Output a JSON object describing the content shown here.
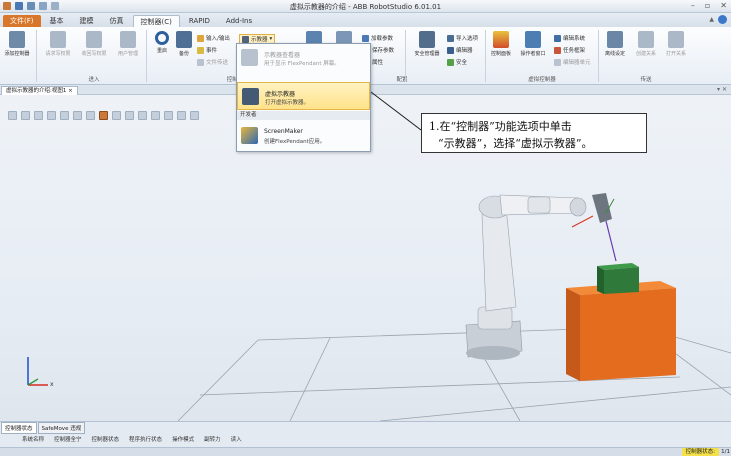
{
  "window": {
    "title": "虚拟示教器的介绍 - ABB RobotStudio 6.01.01"
  },
  "tabs": [
    "文件(F)",
    "基本",
    "建模",
    "仿真",
    "控制器(C)",
    "RAPID",
    "Add-Ins"
  ],
  "ribbon": {
    "add_controller": "添加控制器",
    "request_write": "请求写权限",
    "release_write": "收回写权限",
    "user_manage": "用户管理",
    "restart": "重启",
    "backup": "备份",
    "io": "输入/输出",
    "events": "事件",
    "file_transfer": "文件传送",
    "teach_pendant": "示教器",
    "load_params": "加载参数",
    "save_params": "保存参数",
    "properties": "属性",
    "safety_manager": "安全管理器",
    "import_option": "导入选项",
    "encoder": "编辑器",
    "safety": "安全",
    "control_panel": "控制面板",
    "operator_window": "操作者窗口",
    "edit_system": "编辑系统",
    "task_frame": "任务框架",
    "mech_unit": "编辑器单元",
    "offline": "离线设定",
    "create_relation": "创建关系",
    "open_relation": "打开关系",
    "group_access": "进入",
    "group_controller": "控制器",
    "group_config": "配置",
    "group_virtual": "虚拟控制器",
    "group_transfer": "传送"
  },
  "menu": {
    "item1_title": "示教器查看器",
    "item1_desc": "用于显示 FlexPendant 屏幕。",
    "item2_title": "虚拟示教器",
    "item2_desc": "打开虚拟示教器。",
    "section": "开发者",
    "item3_title": "ScreenMaker",
    "item3_desc": "创建FlexPendant应用。"
  },
  "document_tab": "虚拟示教器的介绍:视图1 ×",
  "callout": {
    "line1": "1.在“控制器”功能选项中单击",
    "line2": "“示教器”，选择“虚拟示教器”。"
  },
  "status_tabs": [
    "控制器状态",
    "SafeMove 违规"
  ],
  "status_columns": [
    "系统名称",
    "控制器全宁",
    "控制器状态",
    "程序执行状态",
    "操作模式",
    "副转力",
    "读入"
  ],
  "statusbar": {
    "controller_status": "控制器状态:",
    "page": "1/1"
  },
  "axis": {
    "x": "x"
  },
  "colors": {
    "accent_file": "#d8772b",
    "box_orange": "#e46c1e",
    "box_green": "#2f7a3a",
    "highlight": "#ffe28a"
  }
}
